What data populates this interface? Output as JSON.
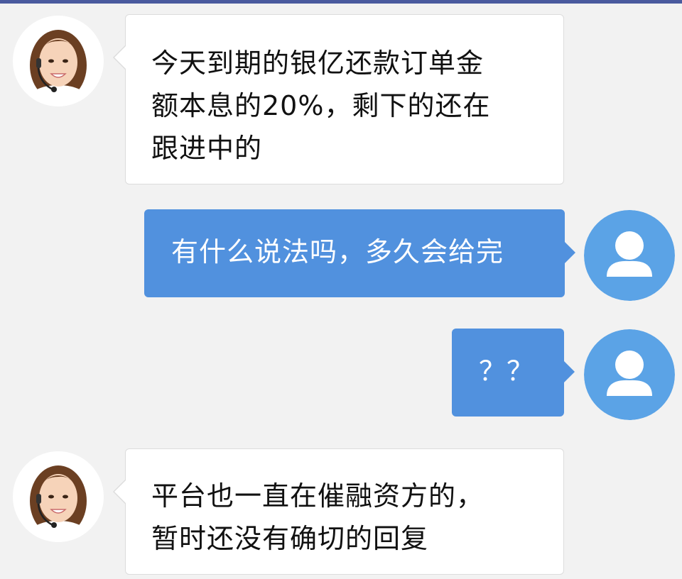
{
  "colors": {
    "user_bubble": "#5191de",
    "agent_bubble": "#ffffff",
    "user_avatar": "#5ba3e6",
    "background": "#f2f2f2",
    "top_bar": "#4a5a9e"
  },
  "messages": [
    {
      "sender": "agent",
      "avatar_icon": "customer-service-agent-avatar",
      "lines": [
        "今天到期的银亿还款订单金",
        "额本息的20%，剩下的还在",
        "跟进中的"
      ]
    },
    {
      "sender": "user",
      "avatar_icon": "default-user-icon",
      "text": "有什么说法吗，多久会给完"
    },
    {
      "sender": "user",
      "avatar_icon": "default-user-icon",
      "text": "？？"
    },
    {
      "sender": "agent",
      "avatar_icon": "customer-service-agent-avatar",
      "lines": [
        "平台也一直在催融资方的，",
        "暂时还没有确切的回复"
      ]
    }
  ]
}
